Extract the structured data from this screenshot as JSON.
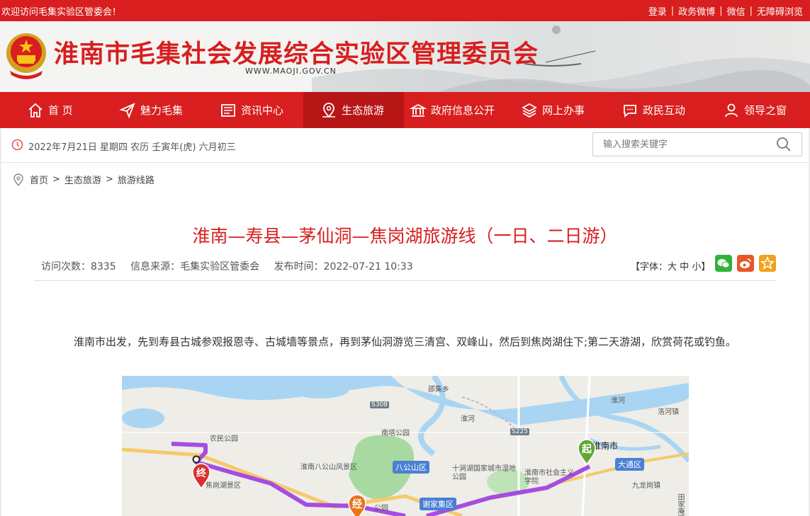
{
  "topbar": {
    "welcome": "欢迎访问毛集实验区管委会！",
    "links": [
      "登录",
      "政务微博",
      "微信",
      "无障碍浏览"
    ]
  },
  "header": {
    "title": "淮南市毛集社会发展综合实验区管理委员会",
    "domain": "WWW.MAOJI.GOV.CN"
  },
  "nav": {
    "items": [
      {
        "label": "首 页",
        "icon": "home-icon"
      },
      {
        "label": "魅力毛集",
        "icon": "paper-plane-icon"
      },
      {
        "label": "资讯中心",
        "icon": "news-icon"
      },
      {
        "label": "生态旅游",
        "icon": "map-pin-icon"
      },
      {
        "label": "政府信息公开",
        "icon": "government-building-icon"
      },
      {
        "label": "网上办事",
        "icon": "layers-icon"
      },
      {
        "label": "政民互动",
        "icon": "chat-icon"
      },
      {
        "label": "领导之窗",
        "icon": "user-icon"
      }
    ],
    "active_index": 3
  },
  "datebar": {
    "date_text": "2022年7月21日 星期四 农历 壬寅年(虎) 六月初三",
    "search_placeholder": "输入搜索关键字"
  },
  "breadcrumb": {
    "items": [
      "首页",
      "生态旅游",
      "旅游线路"
    ],
    "separator": ">"
  },
  "article": {
    "title": "淮南—寿县—茅仙洞—焦岗湖旅游线（一日、二日游）",
    "visits": "访问次数：8335",
    "source": "信息来源：毛集实验区管委会",
    "published": "发布时间：2022-07-21 10:33",
    "font_label_prefix": "【字体：",
    "font_sizes": [
      "大",
      "中",
      "小"
    ],
    "font_label_suffix": "】",
    "paragraph": "淮南市出发，先到寿县古城参观报恩寺、古城墙等景点，再到茅仙洞游览三清宫、双峰山，然后到焦岗湖住下;第二天游湖，欣赏荷花或钓鱼。"
  },
  "map": {
    "labels": {
      "jiji": "邵集乡",
      "huaihe": "淮河",
      "huaihe2": "淮河",
      "luohe": "洛河镇",
      "nongmin": "农民公园",
      "nanta": "南塔公园",
      "bagong": "八公山区",
      "bagongpark": "淮南八公山风景区",
      "shijian": "十涧湖国家城市湿地公园",
      "shiyuan": "淮南市社会主义学院",
      "huainanshi": "淮南市",
      "datong": "大通区",
      "jiulong": "九龙岗镇",
      "jiaogang": "焦岗湖景区",
      "park2": "公园",
      "xiejia": "谢家集区",
      "tianjia": "田家庵区"
    },
    "roads": [
      "S308",
      "S225"
    ],
    "markers": {
      "start": "起",
      "end": "终",
      "via": "经"
    }
  },
  "colors": {
    "brand_red": "#d81e1e",
    "route_purple": "#a54de0",
    "marker_green": "#5fa834",
    "marker_red": "#d8322c",
    "marker_orange": "#e8741c"
  }
}
